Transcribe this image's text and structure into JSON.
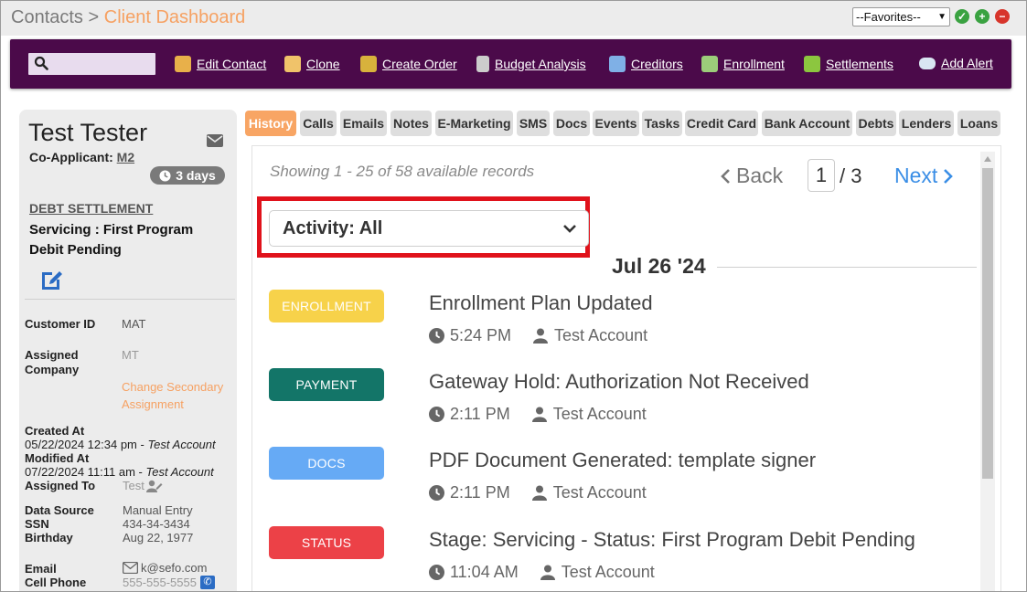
{
  "breadcrumb": {
    "parent": "Contacts",
    "separator": ">",
    "current": "Client Dashboard"
  },
  "favorites": {
    "selected": "--Favorites--"
  },
  "toolbar": {
    "items": [
      {
        "label": "Edit Contact",
        "icon": "edit-contact-icon",
        "color": "#e8b04a"
      },
      {
        "label": "Clone",
        "icon": "clone-icon",
        "color": "#f0c36a"
      },
      {
        "label": "Create Order",
        "icon": "create-order-icon",
        "color": "#d8b23c"
      },
      {
        "label": "Budget Analysis",
        "icon": "calculator-icon",
        "color": "#cccccc"
      },
      {
        "label": "Creditors",
        "icon": "creditors-icon",
        "color": "#7fb0e6"
      },
      {
        "label": "Enrollment",
        "icon": "enrollment-icon",
        "color": "#9ccc7a"
      },
      {
        "label": "Settlements",
        "icon": "settlements-icon",
        "color": "#8cc63f"
      },
      {
        "label": "Add Alert",
        "icon": "alert-icon",
        "color": "#d9e6f2"
      }
    ]
  },
  "contact": {
    "name": "Test Tester",
    "co_applicant_label": "Co-Applicant:",
    "co_applicant_value": "M2",
    "days": "3 days",
    "program_link": "DEBT SETTLEMENT",
    "servicing_line1": "Servicing : First Program",
    "servicing_line2": "Debit Pending",
    "customer_id_label": "Customer ID",
    "customer_id": "MAT",
    "assigned_company_label1": "Assigned",
    "assigned_company_label2": "Company",
    "assigned_company": "MT",
    "change_secondary1": "Change Secondary",
    "change_secondary2": "Assignment",
    "created_label": "Created At",
    "created_date": "05/22/2024 12:34 pm - ",
    "created_by": "Test Account",
    "modified_label": "Modified At",
    "modified_date": "07/22/2024 11:11 am - ",
    "modified_by": "Test Account",
    "assigned_to_label": "Assigned To",
    "assigned_to": "Test",
    "data_source_label": "Data Source",
    "data_source": "Manual Entry",
    "ssn_label": "SSN",
    "ssn": "434-34-3434",
    "birthday_label": "Birthday",
    "birthday": "Aug 22, 1977",
    "email_label": "Email",
    "email": "k@sefo.com",
    "cell_label": "Cell Phone",
    "cell": "555-555-5555"
  },
  "tabs": [
    "History",
    "Calls",
    "Emails",
    "Notes",
    "E-Marketing",
    "SMS",
    "Docs",
    "Events",
    "Tasks",
    "Credit Card",
    "Bank Account",
    "Debts",
    "Lenders",
    "Loans"
  ],
  "active_tab": "History",
  "history": {
    "records_text": "Showing 1 - 25 of 58 available records",
    "back_label": "Back",
    "next_label": "Next",
    "current_page": "1",
    "page_of": "/ 3",
    "activity_filter": "Activity: All",
    "date_header": "Jul 26 '24",
    "events": [
      {
        "badge": "ENROLLMENT",
        "badge_color": "#f7d24a",
        "title": "Enrollment Plan Updated",
        "time": "5:24 PM",
        "user": "Test Account"
      },
      {
        "badge": "PAYMENT",
        "badge_color": "#137568",
        "title": "Gateway Hold: Authorization Not Received",
        "time": "2:11 PM",
        "user": "Test Account"
      },
      {
        "badge": "DOCS",
        "badge_color": "#66aaf5",
        "title": "PDF Document Generated: template  signer",
        "time": "2:11 PM",
        "user": "Test Account"
      },
      {
        "badge": "STATUS",
        "badge_color": "#ec4147",
        "title": "Stage: Servicing - Status: First Program Debit Pending",
        "time": "11:04 AM",
        "user": "Test Account"
      }
    ]
  }
}
